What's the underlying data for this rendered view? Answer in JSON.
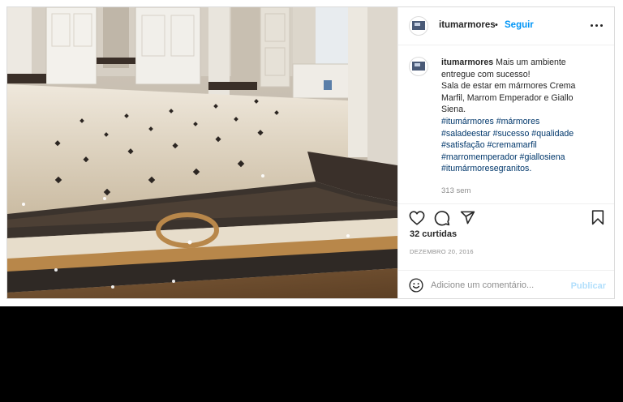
{
  "post": {
    "username": "itumarmores",
    "separator": "•",
    "follow_label": "Seguir",
    "more_icon": "more-horizontal-icon",
    "caption": {
      "username": "itumarmores",
      "lines": [
        "Mais um ambiente",
        "entregue com sucesso!",
        "Sala de estar em mármores Crema",
        "Marfil, Marrom Emperador e Giallo",
        "Siena.",
        "#itumármores #mármores",
        "#saladeestar #sucesso #qualidade",
        "#satisfação #cremamarfil",
        "#marromemperador #giallosiena",
        "#itumármoresegranitos."
      ],
      "time": "313 sem"
    },
    "actions": {
      "like_icon": "heart-icon",
      "comment_icon": "comment-icon",
      "share_icon": "share-icon",
      "save_icon": "bookmark-icon"
    },
    "likes": "32 curtidas",
    "date": "DEZEMBRO 20, 2016",
    "comment": {
      "emoji_icon": "emoji-icon",
      "placeholder": "Adicione um comentário...",
      "value": "",
      "publish_label": "Publicar"
    }
  },
  "colors": {
    "accent": "#0095f6",
    "link": "#00376b",
    "muted": "#8e8e8e",
    "publish_disabled": "#b2dffc",
    "text": "#262626"
  }
}
